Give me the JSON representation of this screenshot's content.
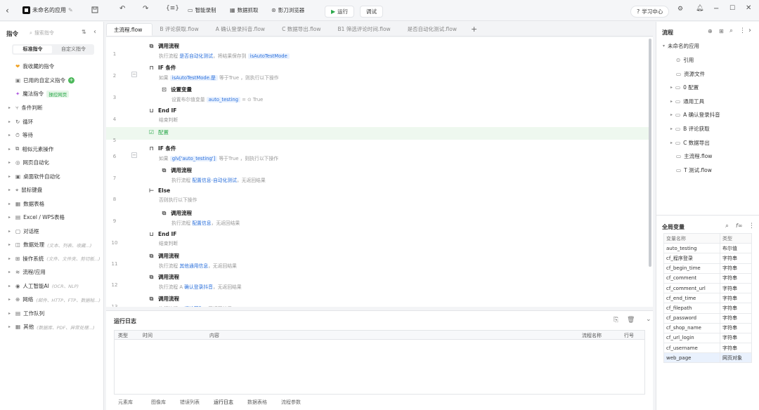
{
  "titlebar": {
    "back": "‹",
    "app_name": "未命名的应用",
    "btn_record": "智能录制",
    "btn_data": "数据抓取",
    "btn_browser": "影刀浏览器",
    "btn_run": "运行",
    "btn_debug": "调试",
    "btn_learn": "学习中心"
  },
  "sidebar": {
    "header": "指令",
    "search_placeholder": "搜索指令",
    "tab_standard": "标准指令",
    "tab_custom": "自定义指令",
    "fav": "我收藏的指令",
    "custom_used": "已用的自定义指令",
    "magic": "魔法指令",
    "magic_badge": "操控网页",
    "categories": [
      {
        "label": "条件判断",
        "sub": ""
      },
      {
        "label": "循环",
        "sub": ""
      },
      {
        "label": "等待",
        "sub": ""
      },
      {
        "label": "相似元素操作",
        "sub": ""
      },
      {
        "label": "网页自动化",
        "sub": ""
      },
      {
        "label": "桌面软件自动化",
        "sub": ""
      },
      {
        "label": "鼠标键盘",
        "sub": ""
      },
      {
        "label": "数据表格",
        "sub": ""
      },
      {
        "label": "Excel / WPS表格",
        "sub": ""
      },
      {
        "label": "对话框",
        "sub": ""
      },
      {
        "label": "数据处理",
        "sub": "(文本、列表、收藏...)"
      },
      {
        "label": "操作系统",
        "sub": "(文件、文件夹、剪切板...)"
      },
      {
        "label": "流程/应用",
        "sub": ""
      },
      {
        "label": "人工智能AI",
        "sub": "(OCR、NLP)"
      },
      {
        "label": "网络",
        "sub": "(邮件、HTTP、FTP、数据帖...)"
      },
      {
        "label": "工作队列",
        "sub": ""
      },
      {
        "label": "其他",
        "sub": "(数据库、PDF、异常处理...)"
      }
    ]
  },
  "file_tabs": [
    "主流程.flow",
    "B 评论获取.flow",
    "A 确认登录抖音.flow",
    "C 数据导出.flow",
    "B1 筛选评论时间.flow",
    "是否自动化测试.flow"
  ],
  "editor": {
    "lines": [
      {
        "num": "1",
        "title": "调用流程",
        "desc_pre": "执行流程",
        "desc_link": "是否自动化测试",
        "desc_mid": "，将结果保存到",
        "desc_chip": "isAutoTestMode",
        "desc_post": ""
      },
      {
        "num": "2",
        "title": "IF 条件",
        "desc_pre": "如果",
        "desc_link": "",
        "desc_mid": "",
        "desc_chip": "isAutoTestMode.是",
        "desc_post": "等于True ，则执行以下操作"
      },
      {
        "num": "3",
        "title": "设置变量",
        "desc_pre": "设置布尔值变量",
        "desc_link": "",
        "desc_mid": "",
        "desc_chip": "auto_testing",
        "desc_post": "= ⊙ True"
      },
      {
        "num": "4",
        "title": "End IF",
        "desc_pre": "结束判断",
        "desc_link": "",
        "desc_mid": "",
        "desc_chip": "",
        "desc_post": ""
      },
      {
        "num": "5",
        "title": "配置",
        "desc_pre": "",
        "desc_link": "",
        "desc_mid": "",
        "desc_chip": "",
        "desc_post": ""
      },
      {
        "num": "6",
        "title": "IF 条件",
        "desc_pre": "如果",
        "desc_link": "",
        "desc_mid": "",
        "desc_chip": "glv['auto_testing']",
        "desc_post": "等于True ，则执行以下操作"
      },
      {
        "num": "7",
        "title": "调用流程",
        "desc_pre": "执行流程",
        "desc_link": "配置信息-自动化测试",
        "desc_mid": "，无返回结果",
        "desc_chip": "",
        "desc_post": ""
      },
      {
        "num": "8",
        "title": "Else",
        "desc_pre": "否则执行以下操作",
        "desc_link": "",
        "desc_mid": "",
        "desc_chip": "",
        "desc_post": ""
      },
      {
        "num": "9",
        "title": "调用流程",
        "desc_pre": "执行流程",
        "desc_link": "配置信息",
        "desc_mid": "，无返回结果",
        "desc_chip": "",
        "desc_post": ""
      },
      {
        "num": "10",
        "title": "End IF",
        "desc_pre": "结束判断",
        "desc_link": "",
        "desc_mid": "",
        "desc_chip": "",
        "desc_post": ""
      },
      {
        "num": "11",
        "title": "调用流程",
        "desc_pre": "执行流程",
        "desc_link": "其他通用信息",
        "desc_mid": "，无返回结果",
        "desc_chip": "",
        "desc_post": ""
      },
      {
        "num": "12",
        "title": "调用流程",
        "desc_pre": "执行流程 A",
        "desc_link": "确认登录抖音",
        "desc_mid": "，无返回结果",
        "desc_chip": "",
        "desc_post": ""
      },
      {
        "num": "13",
        "title": "调用流程",
        "desc_pre": "执行流程 B",
        "desc_link": "评论获取",
        "desc_mid": "，无返回结果",
        "desc_chip": "",
        "desc_post": ""
      }
    ]
  },
  "log": {
    "title": "运行日志",
    "columns": [
      "类型",
      "时间",
      "内容",
      "流程名称",
      "行号"
    ],
    "bottom_tabs": [
      "元素库",
      "图像库",
      "错误列表",
      "运行日志",
      "数据表格",
      "流程参数"
    ]
  },
  "flow_panel": {
    "title": "流程",
    "root": "未命名的应用",
    "items": [
      "引用",
      "资源文件",
      "0 配置",
      "通用工具",
      "A 确认登录抖音",
      "B 评论获取",
      "C 数据导出",
      "主流程.flow",
      "T 测试.flow"
    ]
  },
  "vars": {
    "title": "全局变量",
    "col_name": "变量名称",
    "col_type": "类型",
    "rows": [
      {
        "name": "auto_testing",
        "type": "布尔值"
      },
      {
        "name": "cf_程序登录",
        "type": "字符串"
      },
      {
        "name": "cf_begin_time",
        "type": "字符串"
      },
      {
        "name": "cf_comment",
        "type": "字符串"
      },
      {
        "name": "cf_comment_url",
        "type": "字符串"
      },
      {
        "name": "cf_end_time",
        "type": "字符串"
      },
      {
        "name": "cf_filepath",
        "type": "字符串"
      },
      {
        "name": "cf_password",
        "type": "字符串"
      },
      {
        "name": "cf_shop_name",
        "type": "字符串"
      },
      {
        "name": "cf_url_login",
        "type": "字符串"
      },
      {
        "name": "cf_username",
        "type": "字符串"
      },
      {
        "name": "web_page",
        "type": "网页对象"
      }
    ]
  }
}
